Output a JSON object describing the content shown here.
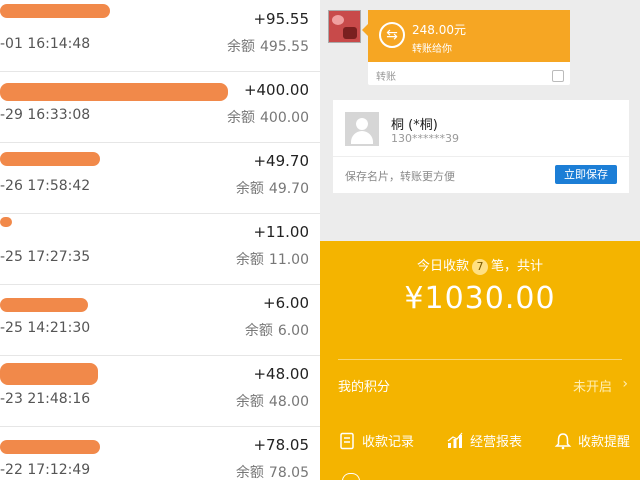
{
  "transactions": [
    {
      "amount": "+95.55",
      "time": "-01 16:14:48",
      "balance_label": "余额",
      "balance": "495.55"
    },
    {
      "amount": "+400.00",
      "time": "-29 16:33:08",
      "balance_label": "余额",
      "balance": "400.00"
    },
    {
      "amount": "+49.70",
      "time": "-26 17:58:42",
      "balance_label": "余额",
      "balance": "49.70"
    },
    {
      "amount": "+11.00",
      "time": "-25 17:27:35",
      "balance_label": "余额",
      "balance": "11.00"
    },
    {
      "amount": "+6.00",
      "time": "-25 14:21:30",
      "balance_label": "余额",
      "balance": "6.00"
    },
    {
      "amount": "+48.00",
      "time": "-23 21:48:16",
      "balance_label": "余额",
      "balance": "48.00"
    },
    {
      "amount": "+78.05",
      "time": "-22 17:12:49",
      "balance_label": "余额",
      "balance": "78.05"
    }
  ],
  "chat": {
    "transfer_amount": "248.00元",
    "transfer_desc": "转账给你",
    "footer": "转账"
  },
  "contact_card": {
    "name": "桐 (*桐)",
    "phone": "130******39",
    "hint": "保存名片，转账更方便",
    "save_button": "立即保存"
  },
  "collection": {
    "today_prefix": "今日收款",
    "count": "7",
    "today_suffix": "笔，共计",
    "total": "¥1030.00",
    "points_label": "我的积分",
    "points_status": "未开启",
    "actions": [
      "收款记录",
      "经营报表",
      "收款提醒"
    ]
  },
  "colors": {
    "orange": "#f6a623",
    "yellow": "#f4b400",
    "blue": "#1c7ed6",
    "scribble": "#f07f3b"
  },
  "icons": [
    "transfer-icon",
    "avatar-icon",
    "chevron-right-icon",
    "receipt-icon",
    "chart-icon",
    "bell-icon"
  ]
}
